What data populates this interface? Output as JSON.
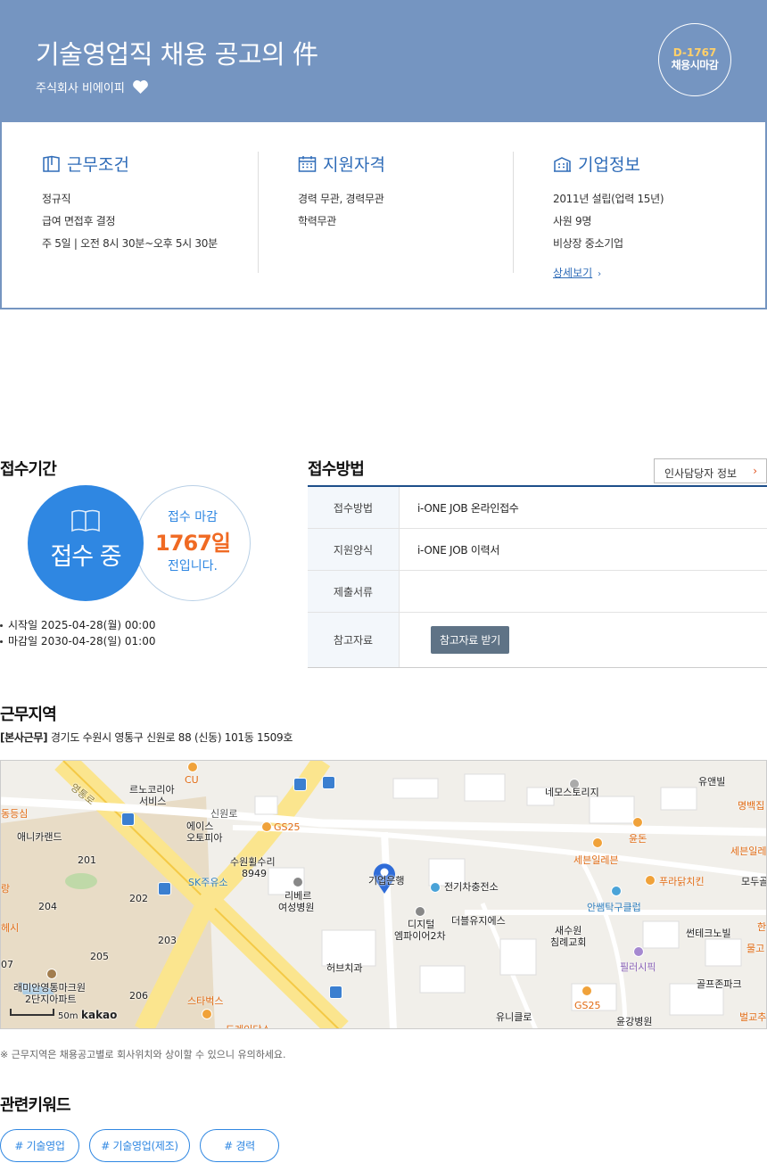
{
  "header": {
    "title": "기술영업직 채용 공고의 件",
    "company": "주식회사 비에이피",
    "dday": "D-1767",
    "dday_sub": "채용시마감"
  },
  "summary": {
    "work": {
      "title": "근무조건",
      "lines": [
        "정규직",
        "급여 면접후 결정",
        "주 5일 | 오전 8시 30분~오후 5시 30분"
      ]
    },
    "qual": {
      "title": "지원자격",
      "lines": [
        "경력 무관, 경력무관",
        "학력무관"
      ]
    },
    "company": {
      "title": "기업정보",
      "lines": [
        "2011년 설립(업력 15년)",
        "사원 9명",
        "비상장 중소기업"
      ],
      "more": "상세보기"
    }
  },
  "period": {
    "title": "접수기간",
    "status": "접수 중",
    "remain_top": "접수 마감",
    "remain_days": "1767일",
    "remain_bottom": "전입니다.",
    "start": "시작일 2025-04-28(월) 00:00",
    "end": "마감일 2030-04-28(일) 01:00"
  },
  "apply": {
    "title": "접수방법",
    "hr_button": "인사담당자 정보",
    "rows": [
      {
        "label": "접수방법",
        "value": "i-ONE JOB 온라인접수"
      },
      {
        "label": "지원양식",
        "value": "i-ONE JOB 이력서"
      },
      {
        "label": "제출서류",
        "value": ""
      },
      {
        "label": "참고자료",
        "button": "참고자료 받기"
      }
    ]
  },
  "location": {
    "title": "근무지역",
    "tag": "[본사근무]",
    "address": "경기도 수원시 영통구 신원로 88 (신동) 101동 1509호",
    "notice": "※ 근무지역은 채용공고별로 회사위치와 상이할 수 있으니 유의하세요.",
    "scale": "50m",
    "brand": "kakao",
    "labels": {
      "l1": "르노코리아",
      "l1b": "서비스",
      "l2": "애니카랜드",
      "l3": "에이스",
      "l3b": "오토피아",
      "l4": "수원휠수리",
      "l4b": "8949",
      "l5": "SK주유소",
      "l6": "리베르",
      "l6b": "여성병원",
      "l7": "기업은행",
      "l8": "전기차충전소",
      "l9": "디지털",
      "l9b": "엠파이어2차",
      "l10": "더블유지에스",
      "l11": "허브치과",
      "l12": "래미안영통마크원",
      "l12b": "2단지아파트",
      "l13": "스타벅스",
      "l14": "네모스토리지",
      "l15": "유앤빌",
      "l16": "명백집",
      "l17": "윤돈",
      "l18": "세븐일레븐",
      "l19": "세븐일레",
      "l20": "푸라닭치킨",
      "l21": "모두골",
      "l22": "안쌤탁구클럽",
      "l23": "새수원",
      "l23b": "침례교회",
      "l24": "썬테크노빌",
      "l25": "필러시픽",
      "l26": "골프존파크",
      "l27": "GS25",
      "l28": "GS25",
      "l29": "유니클로",
      "l30": "윤강병원",
      "l31": "벌교추",
      "l32": "CU",
      "l33": "신원로",
      "l34": "영통로",
      "l35": "201",
      "l36": "202",
      "l37": "203",
      "l38": "204",
      "l39": "205",
      "l40": "206",
      "l41": "동등심",
      "l42": "랑",
      "l43": "헤시",
      "l44": "07",
      "l45": "물고",
      "l46": "한",
      "l47": "도레인당스"
    }
  },
  "keywords": {
    "title": "관련키워드",
    "items": [
      "# 기술영업",
      "# 기술영업(제조)",
      "# 경력"
    ]
  },
  "colors": {
    "hero": "#7595c1",
    "accent": "#2f87e2",
    "orange": "#f06a23"
  }
}
